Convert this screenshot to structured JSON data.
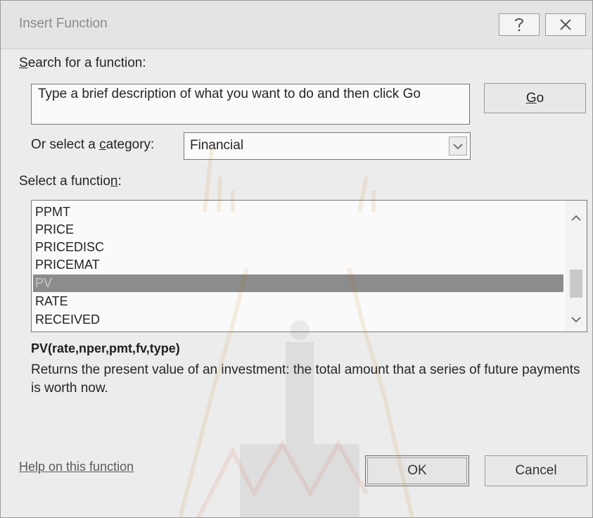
{
  "window": {
    "title": "Insert Function",
    "help_glyph": "?",
    "close_glyph": "✕"
  },
  "search": {
    "label_prefix": "",
    "label_accel": "S",
    "label_rest": "earch for a function:",
    "text": "Type a brief description of what you want to do and then click Go",
    "go_prefix": "",
    "go_accel": "G",
    "go_rest": "o"
  },
  "category": {
    "label_prefix": "Or select a ",
    "label_accel": "c",
    "label_rest": "ategory:",
    "selected": "Financial"
  },
  "function_list": {
    "label_prefix": "Select a functio",
    "label_accel": "n",
    "label_rest": ":",
    "items": [
      "PPMT",
      "PRICE",
      "PRICEDISC",
      "PRICEMAT",
      "PV",
      "RATE",
      "RECEIVED"
    ],
    "selected_index": 4
  },
  "details": {
    "signature": "PV(rate,nper,pmt,fv,type)",
    "description": "Returns the present value of an investment: the total amount that a series of future payments is worth now."
  },
  "footer": {
    "help_link": "Help on this function",
    "ok_label": "OK",
    "cancel_label": "Cancel"
  },
  "colors": {
    "selection_bg": "#8c8c8c",
    "dialog_bg": "#ececec"
  }
}
